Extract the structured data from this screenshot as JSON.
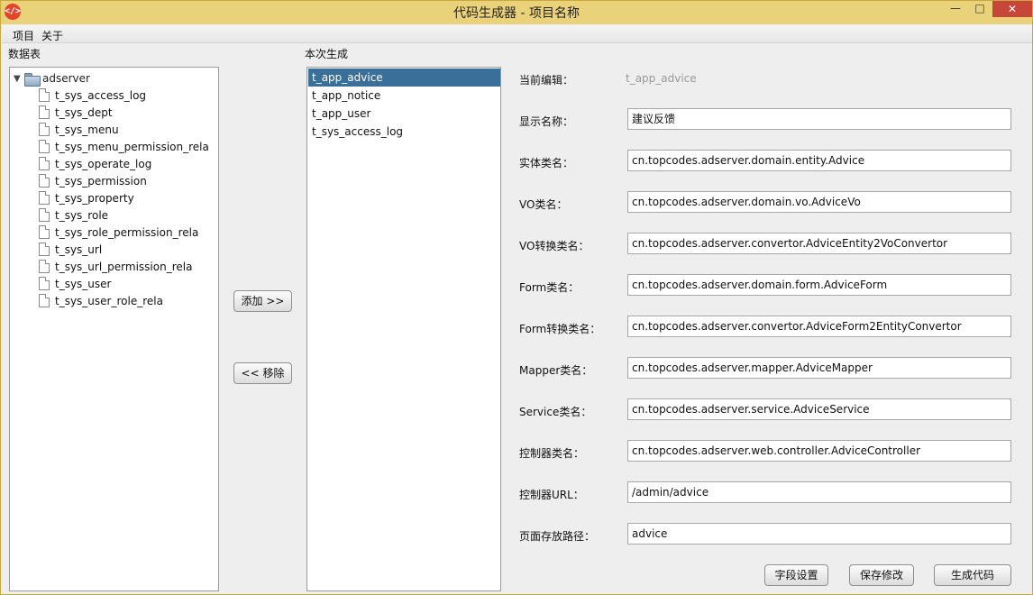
{
  "window": {
    "title": "代码生成器 - 项目名称",
    "app_icon": "</>",
    "controls": {
      "minimize": "—",
      "maximize": "□",
      "close": "✕"
    }
  },
  "menu": {
    "items": [
      "项目",
      "关于"
    ]
  },
  "tables_panel": {
    "label": "数据表",
    "root": {
      "expand_arrow": "▼",
      "name": "adserver"
    },
    "items": [
      "t_sys_access_log",
      "t_sys_dept",
      "t_sys_menu",
      "t_sys_menu_permission_rela",
      "t_sys_operate_log",
      "t_sys_permission",
      "t_sys_property",
      "t_sys_role",
      "t_sys_role_permission_rela",
      "t_sys_url",
      "t_sys_url_permission_rela",
      "t_sys_user",
      "t_sys_user_role_rela"
    ]
  },
  "transfer": {
    "add_label": "添加 >>",
    "remove_label": "<< 移除"
  },
  "generate_panel": {
    "label": "本次生成",
    "items": [
      "t_app_advice",
      "t_app_notice",
      "t_app_user",
      "t_sys_access_log"
    ],
    "selected": "t_app_advice"
  },
  "form": {
    "current_label": "当前编辑：",
    "current_value": "t_app_advice",
    "fields": [
      {
        "label": "显示名称：",
        "value": "建议反馈"
      },
      {
        "label": "实体类名：",
        "value": "cn.topcodes.adserver.domain.entity.Advice"
      },
      {
        "label": "VO类名：",
        "value": "cn.topcodes.adserver.domain.vo.AdviceVo"
      },
      {
        "label": "VO转换类名：",
        "value": "cn.topcodes.adserver.convertor.AdviceEntity2VoConvertor"
      },
      {
        "label": "Form类名：",
        "value": "cn.topcodes.adserver.domain.form.AdviceForm"
      },
      {
        "label": "Form转换类名：",
        "value": "cn.topcodes.adserver.convertor.AdviceForm2EntityConvertor"
      },
      {
        "label": "Mapper类名：",
        "value": "cn.topcodes.adserver.mapper.AdviceMapper"
      },
      {
        "label": "Service类名：",
        "value": "cn.topcodes.adserver.service.AdviceService"
      },
      {
        "label": "控制器类名：",
        "value": "cn.topcodes.adserver.web.controller.AdviceController"
      },
      {
        "label": "控制器URL：",
        "value": "/admin/advice"
      },
      {
        "label": "页面存放路径：",
        "value": "advice"
      }
    ]
  },
  "actions": {
    "field_settings": "字段设置",
    "save_changes": "保存修改",
    "generate_code": "生成代码"
  }
}
